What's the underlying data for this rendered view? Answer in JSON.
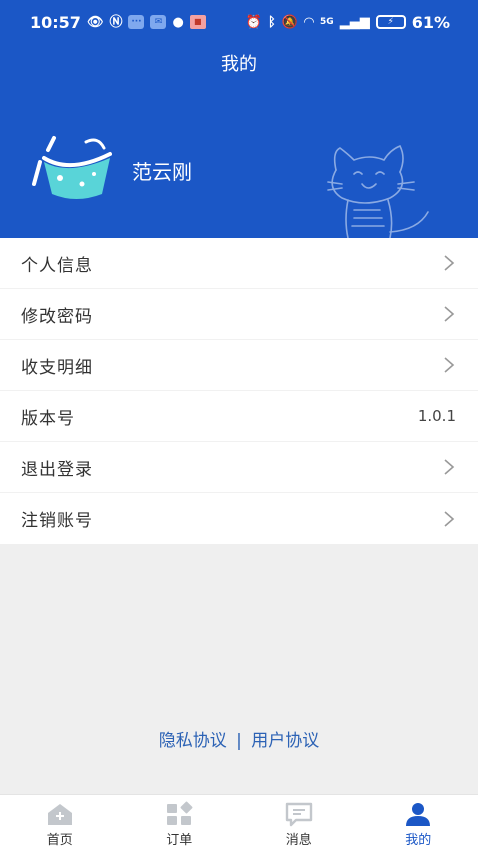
{
  "status_bar": {
    "time": "10:57",
    "battery": "61%",
    "network": "5G"
  },
  "header": {
    "title": "我的",
    "username": "范云刚"
  },
  "menu": {
    "items": [
      {
        "label": "个人信息",
        "value": ""
      },
      {
        "label": "修改密码",
        "value": ""
      },
      {
        "label": "收支明细",
        "value": ""
      },
      {
        "label": "版本号",
        "value": "1.0.1"
      },
      {
        "label": "退出登录",
        "value": ""
      },
      {
        "label": "注销账号",
        "value": ""
      }
    ]
  },
  "agreements": {
    "privacy": "隐私协议",
    "separator": "|",
    "user": "用户协议"
  },
  "tabbar": {
    "items": [
      {
        "label": "首页",
        "icon": "home-icon"
      },
      {
        "label": "订单",
        "icon": "order-icon"
      },
      {
        "label": "消息",
        "icon": "message-icon"
      },
      {
        "label": "我的",
        "icon": "profile-icon"
      }
    ],
    "active_index": 3
  },
  "colors": {
    "brand": "#1b57c6",
    "link": "#2c62b5",
    "inactive_icon": "#b9bdc3"
  }
}
